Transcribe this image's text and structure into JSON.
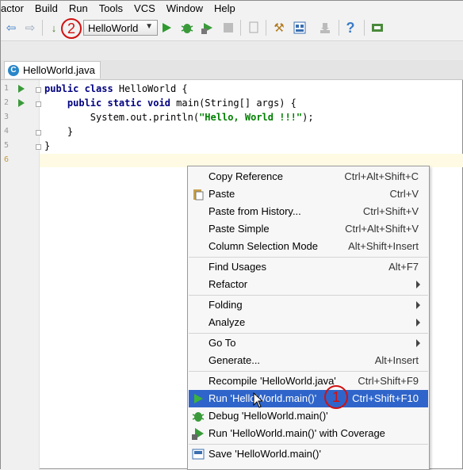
{
  "menubar": {
    "items": [
      "actor",
      "Build",
      "Run",
      "Tools",
      "VCS",
      "Window",
      "Help"
    ]
  },
  "toolbar": {
    "run_config": "HelloWorld",
    "icons": [
      "back-icon",
      "forward-icon",
      "make-icon",
      "run-icon",
      "debug-icon",
      "coverage-icon",
      "stop-icon",
      "settings-icon",
      "project-structure-icon",
      "help-icon",
      "sdk-icon"
    ]
  },
  "editor": {
    "tab_label": "HelloWorld.java",
    "tab_icon_letter": "C",
    "line_numbers": [
      "1",
      "2",
      "3",
      "4",
      "5",
      "6"
    ],
    "code_lines": [
      {
        "kw": "public class",
        "rest": " HelloWorld {"
      },
      {
        "kw": "    public static void",
        "rest": " main(String[] args) {"
      },
      {
        "pre": "        System.out.println(",
        "str": "\"Hello, World !!!\"",
        "post": ");"
      },
      {
        "rest": "    }"
      },
      {
        "rest": "}"
      },
      {
        "rest": ""
      }
    ]
  },
  "context_menu": {
    "items": [
      {
        "label": "Copy Reference",
        "shortcut": "Ctrl+Alt+Shift+C"
      },
      {
        "label": "Paste",
        "shortcut": "Ctrl+V",
        "icon": "clipboard-icon"
      },
      {
        "label": "Paste from History...",
        "shortcut": "Ctrl+Shift+V"
      },
      {
        "label": "Paste Simple",
        "shortcut": "Ctrl+Alt+Shift+V"
      },
      {
        "label": "Column Selection Mode",
        "shortcut": "Alt+Shift+Insert"
      },
      {
        "label": "Find Usages",
        "shortcut": "Alt+F7"
      },
      {
        "label": "Refactor",
        "submenu": true
      },
      {
        "label": "Folding",
        "submenu": true
      },
      {
        "label": "Analyze",
        "submenu": true
      },
      {
        "label": "Go To",
        "submenu": true
      },
      {
        "label": "Generate...",
        "shortcut": "Alt+Insert"
      },
      {
        "label": "Recompile 'HelloWorld.java'",
        "shortcut": "Ctrl+Shift+F9"
      },
      {
        "label": "Run 'HelloWorld.main()'",
        "shortcut": "Ctrl+Shift+F10",
        "icon": "run-icon",
        "highlighted": true
      },
      {
        "label": "Debug 'HelloWorld.main()'",
        "icon": "debug-icon"
      },
      {
        "label": "Run 'HelloWorld.main()' with Coverage",
        "icon": "coverage-icon"
      },
      {
        "label": "Save 'HelloWorld.main()'",
        "icon": "save-icon"
      }
    ]
  },
  "annotations": {
    "step_1": "1",
    "step_2": "2"
  },
  "colors": {
    "highlight": "#2f65ca",
    "annotation_red": "#d01010",
    "run_green": "#3a9a3a"
  }
}
